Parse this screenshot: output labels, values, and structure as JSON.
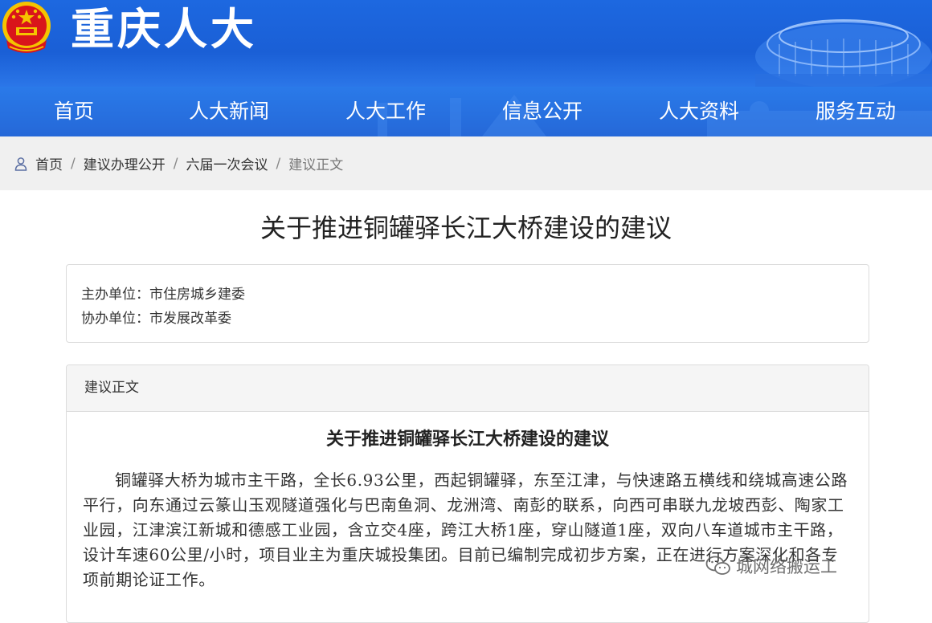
{
  "header": {
    "site_title": "重庆人大",
    "brand_color": "#1d68e0"
  },
  "nav": {
    "items": [
      "首页",
      "人大新闻",
      "人大工作",
      "信息公开",
      "人大资料",
      "服务互动"
    ]
  },
  "breadcrumb": {
    "items": [
      "首页",
      "建议办理公开",
      "六届一次会议",
      "建议正文"
    ],
    "separator": "/"
  },
  "page": {
    "title": "关于推进铜罐驿长江大桥建设的建议",
    "host_unit_label": "主办单位：",
    "host_unit": "市住房城乡建委",
    "co_unit_label": "协办单位：",
    "co_unit": "市发展改革委"
  },
  "panel": {
    "heading": "建议正文",
    "doc_title": "关于推进铜罐驿长江大桥建设的建议",
    "paragraph": "铜罐驿大桥为城市主干路，全长6.93公里，西起铜罐驿，东至江津，与快速路五横线和绕城高速公路平行，向东通过云篆山玉观隧道强化与巴南鱼洞、龙洲湾、南彭的联系，向西可串联九龙坡西彭、陶家工业园，江津滨江新城和德感工业园，含立交4座，跨江大桥1座，穿山隧道1座，双向八车道城市主干路，设计车速60公里/小时，项目业主为重庆城投集团。目前已编制完成初步方案，正在进行方案深化和各专项前期论证工作。"
  },
  "watermark": {
    "icon": "wechat-icon",
    "text": "城网络搬运工"
  }
}
